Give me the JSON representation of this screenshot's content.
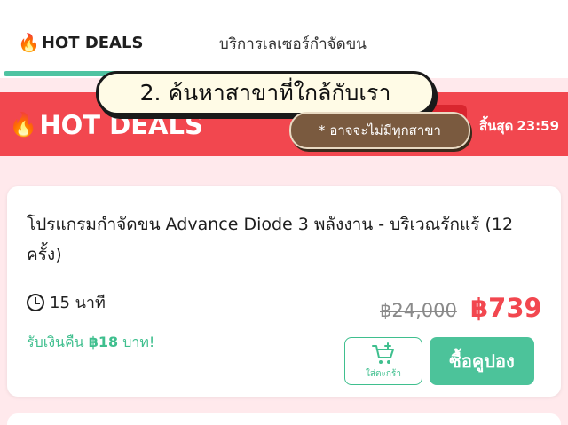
{
  "tabs": {
    "hot_deals": "HOT DEALS",
    "laser": "บริการเลเซอร์กำจัดขน"
  },
  "banner": {
    "title": "HOT DEALS",
    "ends_label": "สิ้นสุด",
    "ends_time": "23:59"
  },
  "overlay": {
    "main": "2. ค้นหาสาขาที่ใกล้กับเรา",
    "note": "* อาจจะไม่มีทุกสาขา"
  },
  "product": {
    "title": "โปรแกรมกำจัดขน Advance Diode 3 พลังงาน - บริเวณรักแร้ (12 ครั้ง)",
    "duration": "15 นาที",
    "old_price": "฿24,000",
    "new_price": "฿739",
    "cashback_prefix": "รับเงินคืน ",
    "cashback_amount": "฿18",
    "cashback_suffix": " บาท!",
    "cart_label": "ใส่ตะกร้า",
    "buy_label": "ซื้อคูปอง"
  },
  "colors": {
    "accent_red": "#f2474f",
    "accent_green": "#4cc39a"
  },
  "icons": [
    "fire-icon",
    "clock-icon",
    "cart-plus-icon"
  ]
}
